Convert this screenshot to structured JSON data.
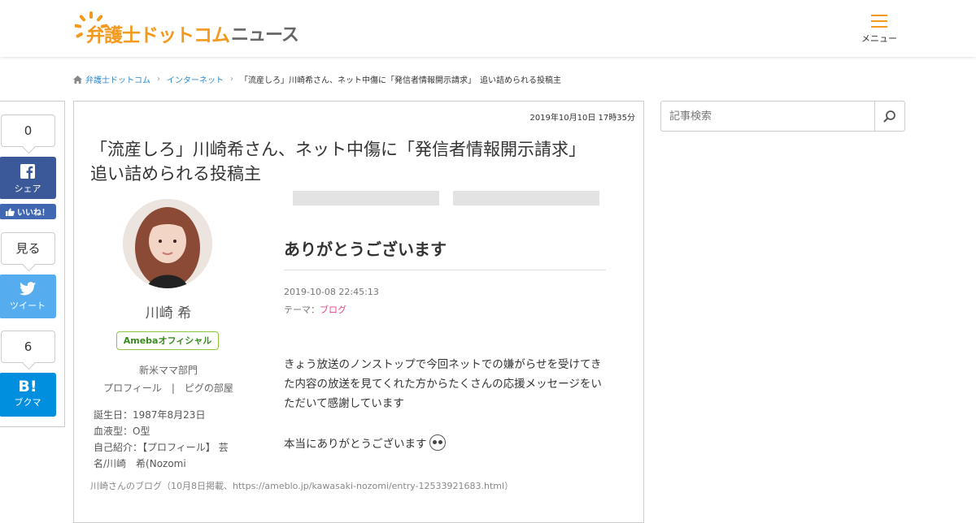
{
  "header": {
    "logo_main": "弁護士ドットコム",
    "logo_sub": "ニュース",
    "menu_label": "メニュー"
  },
  "breadcrumb": {
    "items": [
      "弁護士ドットコム",
      "インターネット"
    ],
    "current": "「流産しろ」川崎希さん、ネット中傷に「発信者情報開示請求」　追い詰められる投稿主"
  },
  "share": {
    "facebook_count": "0",
    "facebook_label": "シェア",
    "like_label": "いいね！",
    "twitter_count": "見る",
    "twitter_label": "ツイート",
    "hatena_count": "6",
    "hatena_logo": "B!",
    "hatena_label": "ブクマ"
  },
  "article": {
    "date": "2019年10月10日 17時35分",
    "title": "「流産しろ」川崎希さん、ネット中傷に「発信者情報開示請求」　追い詰められる投稿主",
    "image": {
      "profile_name": "川崎 希",
      "badge": "Amebaオフィシャル",
      "group": "新米ママ部門",
      "profile_links": "プロフィール　|　ピグの部屋",
      "profile_lines": [
        "誕生日：1987年8月23日",
        "血液型：O型",
        "自己紹介：【プロフィール】 芸",
        "名/川崎　希(Nozomi"
      ],
      "post_title": "ありがとうございます",
      "post_date": "2019-10-08 22:45:13",
      "post_theme_label": "テーマ：",
      "post_theme": "ブログ",
      "post_body": "きょう放送のノンストップで今回ネットでの嫌がらせを受けてきた内容の放送を見てくれた方からたくさんの応援メッセージをいただいて感謝しています",
      "post_thanks": "本当にありがとうございます"
    },
    "caption": "川崎さんのブログ（10月8日掲載、https://ameblo.jp/kawasaki-nozomi/entry-12533921683.html）"
  },
  "search": {
    "placeholder": "記事検索"
  },
  "colors": {
    "brand_orange": "#f39a1e",
    "link_blue": "#2f8ad1",
    "facebook": "#3b5998",
    "twitter": "#55acee",
    "hatena": "#008fde"
  }
}
